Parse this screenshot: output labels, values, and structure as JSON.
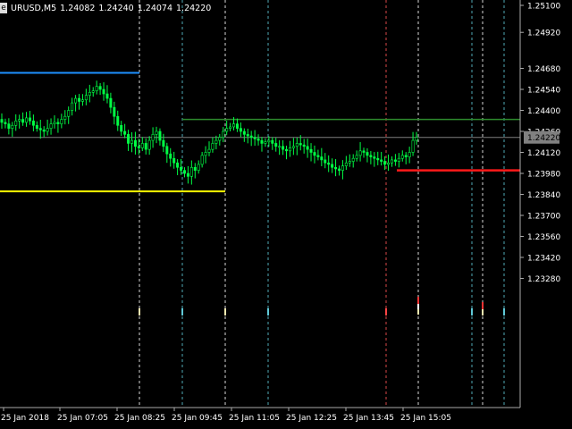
{
  "header": {
    "icon_label": "e",
    "symbol": "URUSD,M5",
    "open": "1.24082",
    "high": "1.24240",
    "low": "1.24074",
    "close": "1.24220"
  },
  "colors": {
    "background": "#000000",
    "candle": "#00ff44",
    "grid": "#aaaaaa",
    "blue_line": "#1e90ff",
    "yellow_line": "#ffff00",
    "green_line": "#2e8b2e",
    "red_line": "#ff1a1a",
    "price_line": "#808080",
    "dotted_white": "#ffffff",
    "dotted_cyan": "#5fc8d6",
    "dotted_red": "#ff5555",
    "price_box": "#808080"
  },
  "chart_data": {
    "type": "candlestick",
    "symbol": "URUSD,M5",
    "y_ticks": [
      "1.25100",
      "1.24920",
      "1.24680",
      "1.24540",
      "1.24400",
      "1.24260",
      "1.24120",
      "1.23980",
      "1.23840",
      "1.23700",
      "1.23560",
      "1.23420",
      "1.23280"
    ],
    "y_tick_values": [
      1.251,
      1.2492,
      1.2468,
      1.2454,
      1.244,
      1.2426,
      1.2412,
      1.2398,
      1.2384,
      1.237,
      1.2356,
      1.2342,
      1.2328
    ],
    "x_ticks": [
      "25 Jan 2018",
      "25 Jan 07:05",
      "25 Jan 08:25",
      "25 Jan 09:45",
      "25 Jan 11:05",
      "25 Jan 12:25",
      "25 Jan 13:45",
      "25 Jan 15:05"
    ],
    "current_price": "1.24220",
    "current_price_value": 1.2422,
    "closes": [
      1.2432,
      1.2431,
      1.2428,
      1.243,
      1.2433,
      1.2434,
      1.2432,
      1.2435,
      1.2433,
      1.243,
      1.2428,
      1.2427,
      1.2426,
      1.2428,
      1.2431,
      1.2432,
      1.2431,
      1.2434,
      1.2436,
      1.244,
      1.2445,
      1.2448,
      1.2446,
      1.2447,
      1.245,
      1.2452,
      1.2453,
      1.2456,
      1.2454,
      1.2451,
      1.2448,
      1.2442,
      1.2436,
      1.243,
      1.2426,
      1.2424,
      1.2418,
      1.242,
      1.2416,
      1.2415,
      1.2418,
      1.2414,
      1.242,
      1.2424,
      1.2426,
      1.242,
      1.2416,
      1.2411,
      1.2408,
      1.2405,
      1.2402,
      1.24,
      1.2398,
      1.2396,
      1.2402,
      1.24,
      1.2404,
      1.241,
      1.2412,
      1.2414,
      1.2418,
      1.242,
      1.2422,
      1.2426,
      1.2428,
      1.2429,
      1.2431,
      1.2428,
      1.2426,
      1.2424,
      1.2423,
      1.2422,
      1.2421,
      1.242,
      1.2418,
      1.2419,
      1.242,
      1.2418,
      1.2416,
      1.2416,
      1.2414,
      1.2413,
      1.2415,
      1.2416,
      1.2418,
      1.2417,
      1.2416,
      1.2414,
      1.2412,
      1.241,
      1.2409,
      1.2407,
      1.2405,
      1.2404,
      1.2402,
      1.2401,
      1.24,
      1.2403,
      1.2405,
      1.2406,
      1.2408,
      1.241,
      1.2413,
      1.2412,
      1.241,
      1.2409,
      1.2408,
      1.2407,
      1.2406,
      1.2404,
      1.2405,
      1.2407,
      1.2406,
      1.2408,
      1.241,
      1.2409,
      1.2412,
      1.242,
      1.2422
    ]
  },
  "lines": {
    "blue_price": 1.2465,
    "yellow_price": 1.2386,
    "green_price": 1.2434,
    "red_price": 1.24
  }
}
